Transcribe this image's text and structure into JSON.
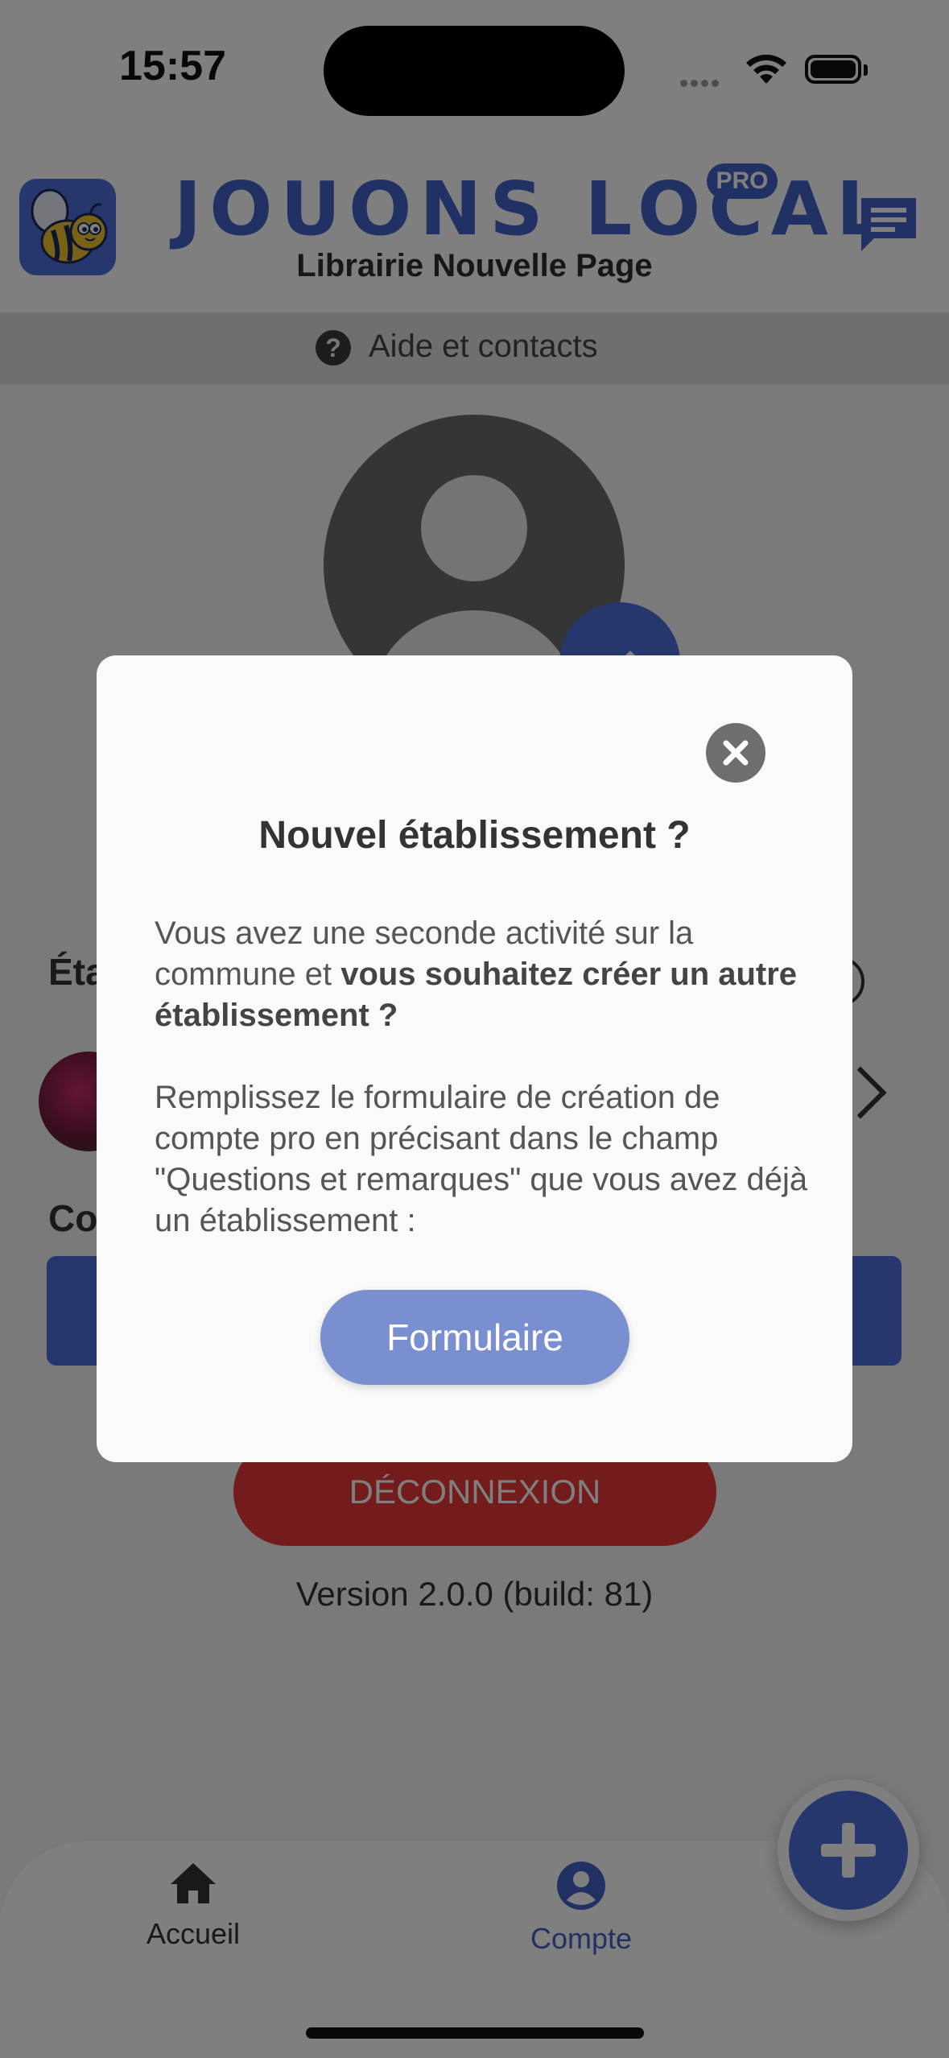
{
  "status_bar": {
    "time": "15:57"
  },
  "header": {
    "brand": "JOUONS LOCAL",
    "badge": "PRO",
    "subtitle": "Librairie Nouvelle Page"
  },
  "help_bar": {
    "icon_glyph": "?",
    "label": "Aide et contacts"
  },
  "background": {
    "establishments_label_partial": "Éta",
    "contact_label_partial": "Co",
    "logout_label": "DÉCONNEXION",
    "version": "Version 2.0.0 (build: 81)"
  },
  "tab_bar": {
    "items": [
      {
        "label": "Accueil",
        "icon": "home-icon"
      },
      {
        "label": "Compte",
        "icon": "account-icon"
      }
    ],
    "active": "Compte"
  },
  "modal": {
    "title": "Nouvel établissement ?",
    "p1_part1": "Vous avez une seconde activité sur la commune et ",
    "p1_bold": "vous souhaitez créer un autre établissement ?",
    "p2": "Remplissez le formulaire de création de compte pro en précisant dans le champ \"Questions et remarques\" que vous avez déjà un établissement :",
    "button_label": "Formulaire"
  },
  "colors": {
    "brand_blue": "#4563c8",
    "logout_red": "#e83838",
    "form_button": "#7a8fcf"
  }
}
